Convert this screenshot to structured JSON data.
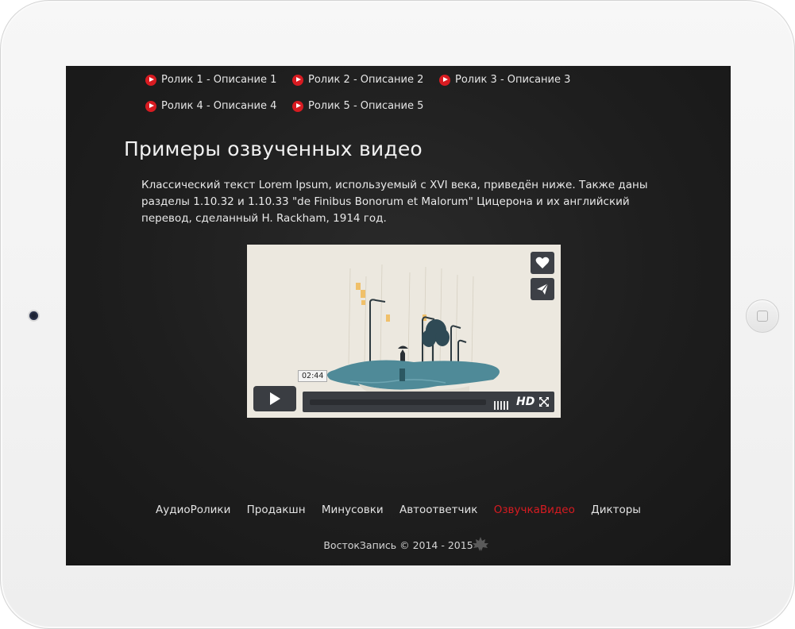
{
  "videos": [
    {
      "label": "Ролик 1 - Описание 1"
    },
    {
      "label": "Ролик 2 - Описание 2"
    },
    {
      "label": "Ролик 3 - Описание 3"
    },
    {
      "label": "Ролик 4 - Описание 4"
    },
    {
      "label": "Ролик 5 - Описание 5"
    }
  ],
  "page": {
    "title": "Примеры озвученных видео",
    "description": "Классический текст Lorem Ipsum, используемый с XVI века, приведён ниже. Также даны разделы 1.10.32 и 1.10.33 \"de Finibus Bonorum et Malorum\" Цицерона и их английский перевод, сделанный H. Rackham, 1914 год."
  },
  "player": {
    "time": "02:44",
    "hd_label": "HD",
    "progress": 0
  },
  "footer": {
    "nav": [
      {
        "label": "АудиоРолики",
        "active": false
      },
      {
        "label": "Продакшн",
        "active": false
      },
      {
        "label": "Минусовки",
        "active": false
      },
      {
        "label": "Автоответчик",
        "active": false
      },
      {
        "label": "ОзвучкаВидео",
        "active": true
      },
      {
        "label": "Дикторы",
        "active": false
      }
    ],
    "copyright": "ВостокЗапись © 2014 - 2015"
  },
  "colors": {
    "accent": "#d81b21",
    "screen_bg": "#1e1e1e",
    "player_bg": "#ece8df"
  }
}
